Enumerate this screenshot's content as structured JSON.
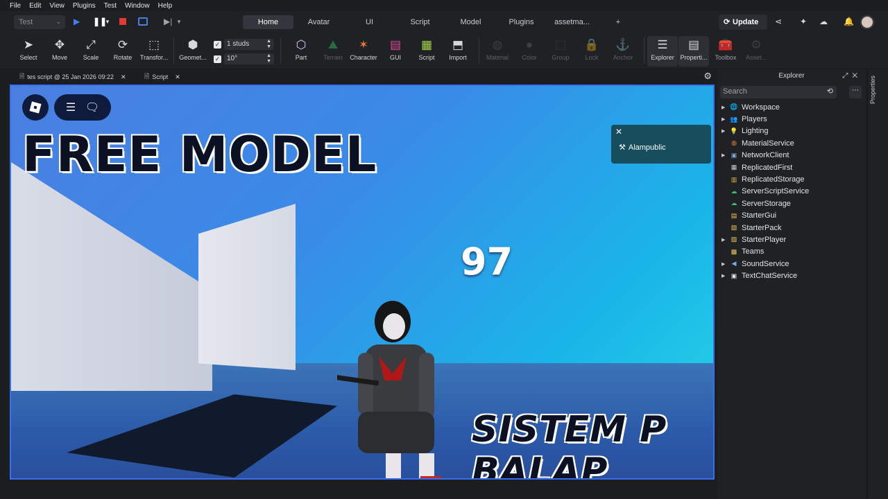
{
  "menubar": [
    "File",
    "Edit",
    "View",
    "Plugins",
    "Test",
    "Window",
    "Help"
  ],
  "topbar": {
    "mode_select": "Test",
    "tabs": [
      "Home",
      "Avatar",
      "UI",
      "Script",
      "Model",
      "Plugins",
      "assetma...",
      "+"
    ],
    "active_tab": "Home",
    "update_label": "Update"
  },
  "ribbon": {
    "tools": [
      "Select",
      "Move",
      "Scale",
      "Rotate",
      "Transfor...",
      "Geomet..."
    ],
    "snap": {
      "move_value": "1 studs",
      "rotate_value": "10°"
    },
    "insert": [
      "Part",
      "Terrain",
      "Character",
      "GUI",
      "Script",
      "Import"
    ],
    "appearance": [
      "Material",
      "Color",
      "Group",
      "Lock",
      "Anchor"
    ],
    "panels": [
      "Explorer",
      "Properti...",
      "Toolbox",
      "Asset..."
    ]
  },
  "doc_tabs": [
    "tes script @ 25 Jan 2026 09:22",
    "Script"
  ],
  "viewport": {
    "title_top": "FREE MODEL",
    "title_bottom": "SISTEM P BALAP",
    "score": "97",
    "notification": "Alampublic"
  },
  "explorer": {
    "title": "Explorer",
    "search_placeholder": "Search",
    "items": [
      {
        "label": "Workspace",
        "icon": "globe-icon",
        "color": "#3aa0e8",
        "expandable": true
      },
      {
        "label": "Players",
        "icon": "players-icon",
        "color": "#4caf50",
        "expandable": true
      },
      {
        "label": "Lighting",
        "icon": "bulb-icon",
        "color": "#f5d742",
        "expandable": true
      },
      {
        "label": "MaterialService",
        "icon": "material-icon",
        "color": "#e8884a",
        "expandable": false
      },
      {
        "label": "NetworkClient",
        "icon": "network-icon",
        "color": "#7fa7d6",
        "expandable": true
      },
      {
        "label": "ReplicatedFirst",
        "icon": "replicated-first-icon",
        "color": "#c9ccd1",
        "expandable": false
      },
      {
        "label": "ReplicatedStorage",
        "icon": "replicated-storage-icon",
        "color": "#e8b84a",
        "expandable": false
      },
      {
        "label": "ServerScriptService",
        "icon": "server-script-icon",
        "color": "#3fbf6a",
        "expandable": false
      },
      {
        "label": "ServerStorage",
        "icon": "server-storage-icon",
        "color": "#3fbf6a",
        "expandable": false
      },
      {
        "label": "StarterGui",
        "icon": "starter-gui-icon",
        "color": "#f0c857",
        "expandable": false
      },
      {
        "label": "StarterPack",
        "icon": "starter-pack-icon",
        "color": "#f0c857",
        "expandable": false
      },
      {
        "label": "StarterPlayer",
        "icon": "starter-player-icon",
        "color": "#f0c857",
        "expandable": true
      },
      {
        "label": "Teams",
        "icon": "teams-icon",
        "color": "#f0c857",
        "expandable": false
      },
      {
        "label": "SoundService",
        "icon": "sound-icon",
        "color": "#6fb3e8",
        "expandable": true
      },
      {
        "label": "TextChatService",
        "icon": "chat-icon",
        "color": "#e2e4e8",
        "expandable": true
      }
    ]
  },
  "properties_strip": "Properties"
}
